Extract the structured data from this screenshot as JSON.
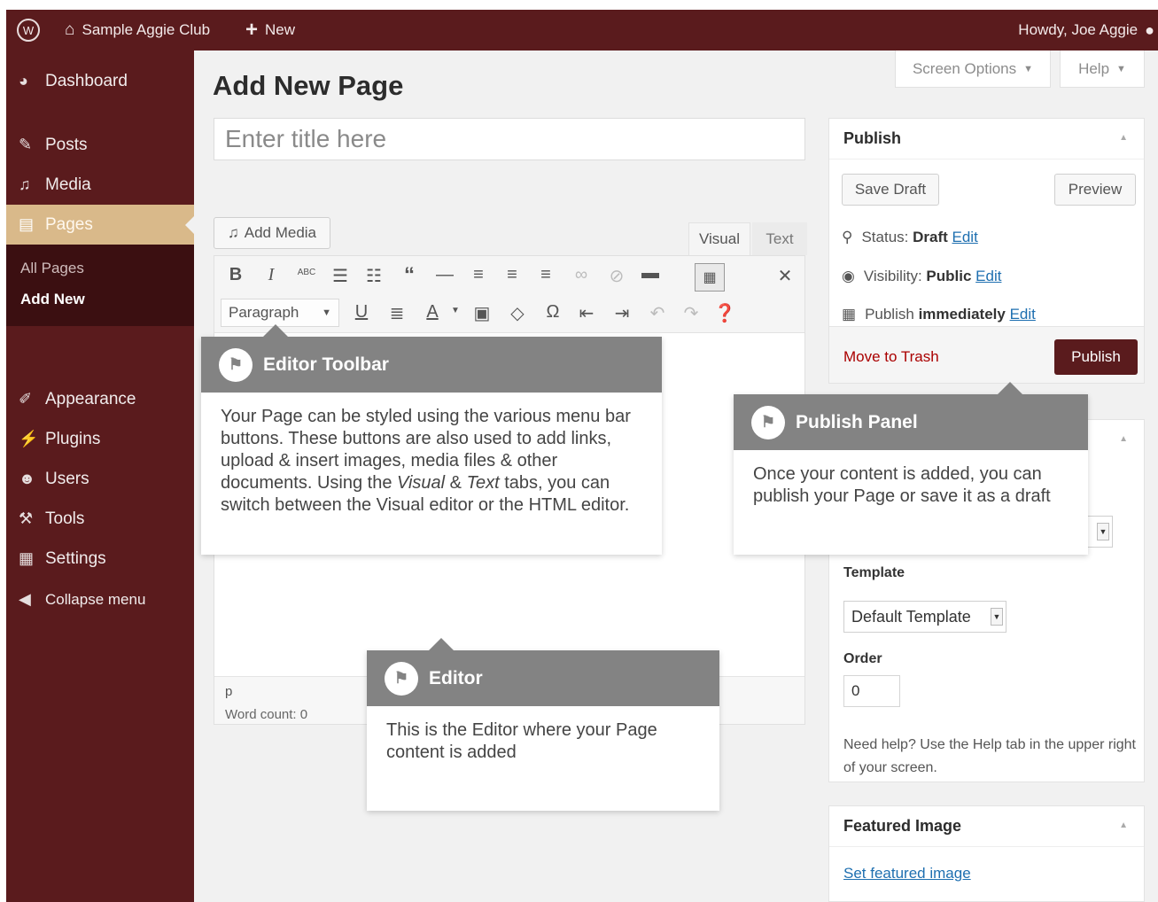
{
  "admin_bar": {
    "site_name": "Sample Aggie Club",
    "new_label": "New",
    "howdy": "Howdy, Joe Aggie"
  },
  "sidebar": {
    "items": [
      {
        "label": "Dashboard",
        "icon": "dashboard-icon"
      },
      {
        "label": "Posts",
        "icon": "pin-icon"
      },
      {
        "label": "Media",
        "icon": "media-icon"
      },
      {
        "label": "Pages",
        "icon": "pages-icon"
      },
      {
        "label": "Appearance",
        "icon": "brush-icon"
      },
      {
        "label": "Plugins",
        "icon": "plug-icon"
      },
      {
        "label": "Users",
        "icon": "user-icon"
      },
      {
        "label": "Tools",
        "icon": "wrench-icon"
      },
      {
        "label": "Settings",
        "icon": "settings-icon"
      }
    ],
    "submenu": [
      "All Pages",
      "Add New"
    ],
    "collapse": "Collapse menu"
  },
  "header": {
    "screen_options": "Screen Options",
    "help": "Help",
    "page_title": "Add New Page"
  },
  "editor": {
    "title_placeholder": "Enter title here",
    "add_media": "Add Media",
    "tab_visual": "Visual",
    "tab_text": "Text",
    "format_select": "Paragraph",
    "path": "p",
    "word_count": "Word count: 0"
  },
  "publish": {
    "title": "Publish",
    "save_draft": "Save Draft",
    "preview": "Preview",
    "status_label": "Status:",
    "status_value": "Draft",
    "visibility_label": "Visibility:",
    "visibility_value": "Public",
    "schedule_label": "Publish",
    "schedule_value": "immediately",
    "edit": "Edit",
    "trash": "Move to Trash",
    "publish_button": "Publish"
  },
  "attributes": {
    "template_label": "Template",
    "template_value": "Default Template",
    "order_label": "Order",
    "order_value": "0",
    "help_text": "Need help? Use the Help tab in the upper right of your screen."
  },
  "featured": {
    "title": "Featured Image",
    "link": "Set featured image"
  },
  "pointers": {
    "toolbar": {
      "title": "Editor Toolbar",
      "body_1": "Your Page can be styled using the various menu bar buttons. These buttons are also used to add links, upload & insert images, media files & other documents. Using the ",
      "body_visual": "Visual",
      "body_amp": " & ",
      "body_text": "Text",
      "body_2": " tabs, you can switch between the Visual editor or the HTML editor."
    },
    "publish": {
      "title": "Publish Panel",
      "body": "Once your content is added, you can publish your Page or save it as a draft"
    },
    "editor": {
      "title": "Editor",
      "body": "This is the Editor where your Page content is added"
    }
  }
}
